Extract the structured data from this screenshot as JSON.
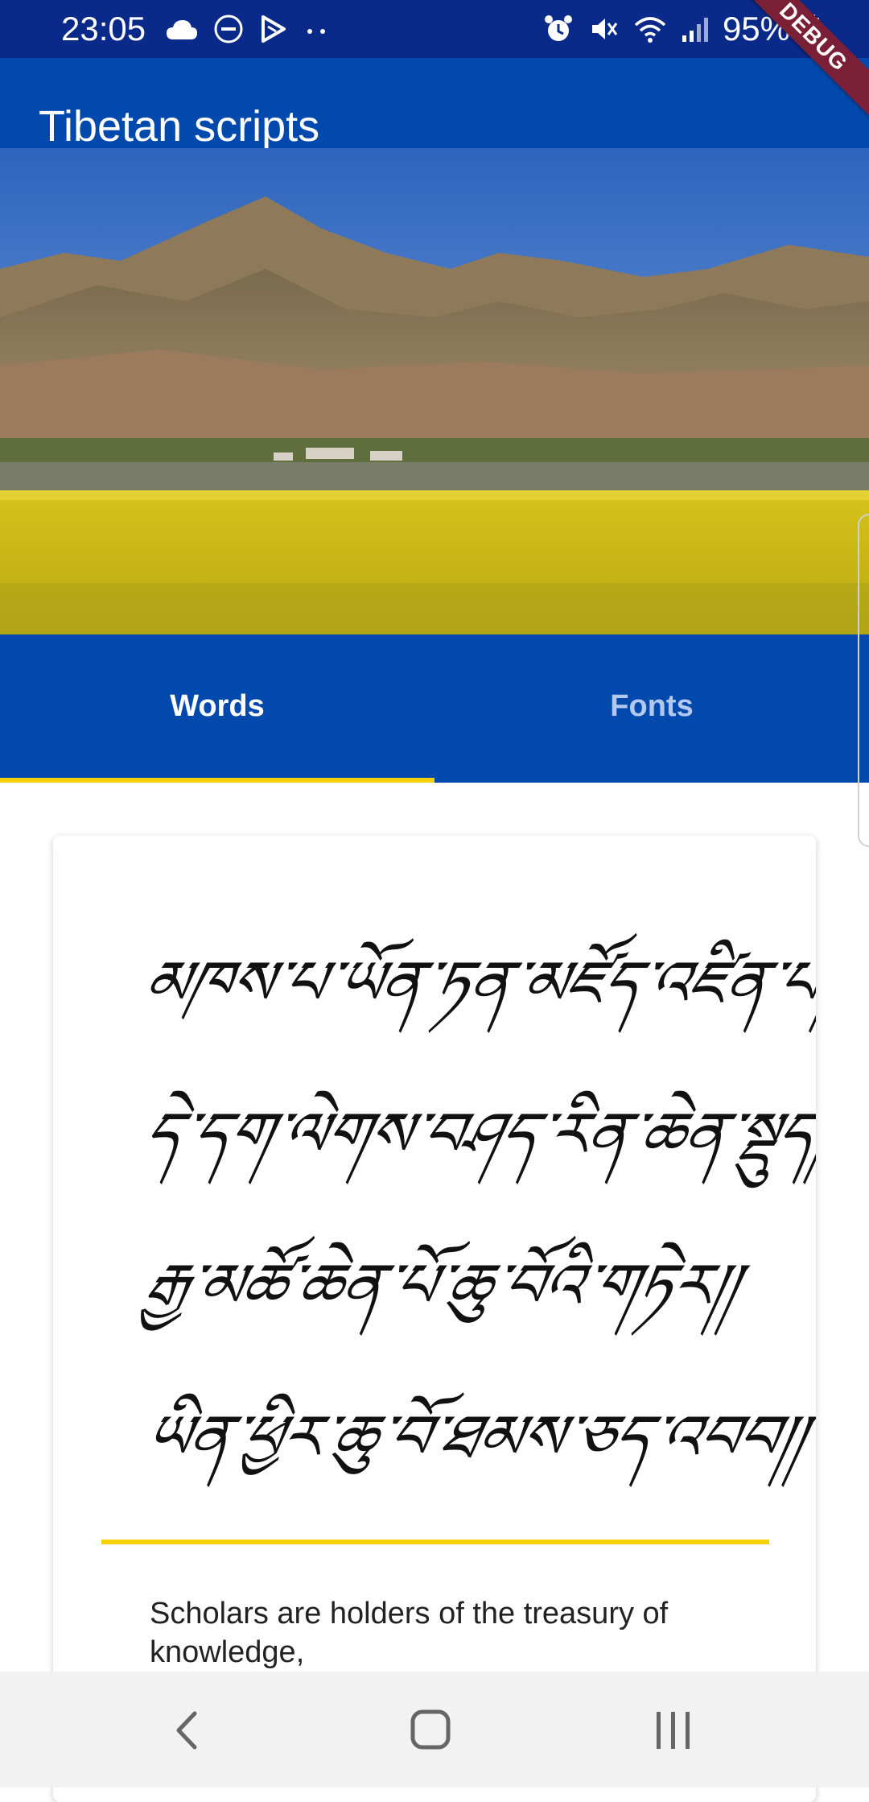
{
  "status_bar": {
    "time": "23:05",
    "battery": "95%",
    "left_icons": [
      "cloud-icon",
      "do-not-disturb-icon",
      "play-store-icon",
      "more-dots-icon"
    ],
    "right_icons": [
      "alarm-icon",
      "mute-icon",
      "wifi-icon",
      "signal-icon",
      "battery-icon"
    ]
  },
  "app_bar": {
    "title": "Tibetan scripts"
  },
  "debug_banner": "DEBUG",
  "tabs": [
    {
      "label": "Words",
      "selected": true
    },
    {
      "label": "Fonts",
      "selected": false
    }
  ],
  "card": {
    "script_lines": [
      "མཁས་པ་ཡོན་ཏན་མཛོད་འཛིན་པ།།",
      "དེ་དག་ལེགས་བཤད་རིན་ཆེན་སྡུད།།",
      "རྒྱ་མཚོ་ཆེན་པོ་ཆུ་བོའི་གཏེར།།",
      "ཡིན་ཕྱིར་ཆུ་བོ་ཐམས་ཅད་འབབ།།"
    ],
    "translation": "Scholars are holders of the treasury of knowledge,"
  },
  "colors": {
    "status_bar": "#0a2a8a",
    "primary": "#0249ad",
    "indicator": "#f5d10a",
    "debug": "#7a1f35"
  },
  "nav_bar": {
    "buttons": [
      "back-icon",
      "home-icon",
      "recents-icon"
    ]
  }
}
